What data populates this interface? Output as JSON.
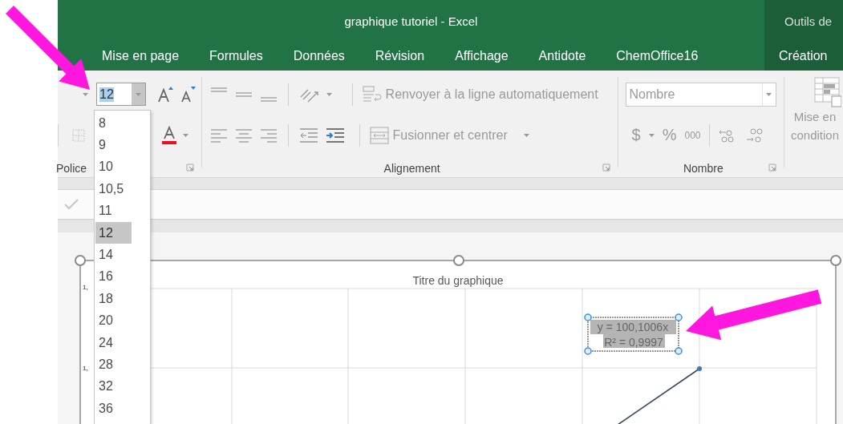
{
  "window": {
    "title": "graphique tutoriel - Excel",
    "context_group": "Outils de"
  },
  "tabs": [
    {
      "label": "Mise en page",
      "kind": "normal"
    },
    {
      "label": "Formules",
      "kind": "normal"
    },
    {
      "label": "Données",
      "kind": "normal"
    },
    {
      "label": "Révision",
      "kind": "normal"
    },
    {
      "label": "Affichage",
      "kind": "normal"
    },
    {
      "label": "Antidote",
      "kind": "normal"
    },
    {
      "label": "ChemOffice16",
      "kind": "normal"
    },
    {
      "label": "Création",
      "kind": "contextual"
    }
  ],
  "ribbon": {
    "font": {
      "size": "12",
      "group_label": "Police"
    },
    "alignment": {
      "wrap_label": "Renvoyer à la ligne automatiquement",
      "merge_label": "Fusionner et centrer",
      "group_label": "Alignement"
    },
    "number": {
      "format": "Nombre",
      "currency": "$",
      "percent": "%",
      "thousands": "000",
      "group_label": "Nombre"
    },
    "styles": {
      "conditional_label_lines": [
        "Mise en",
        "condition"
      ]
    }
  },
  "font_sizes": [
    {
      "label": "8",
      "selected": false
    },
    {
      "label": "9",
      "selected": false
    },
    {
      "label": "10",
      "selected": false
    },
    {
      "label": "10,5",
      "selected": false
    },
    {
      "label": "11",
      "selected": false
    },
    {
      "label": "12",
      "selected": true
    },
    {
      "label": "14",
      "selected": false
    },
    {
      "label": "16",
      "selected": false
    },
    {
      "label": "18",
      "selected": false
    },
    {
      "label": "20",
      "selected": false
    },
    {
      "label": "24",
      "selected": false
    },
    {
      "label": "28",
      "selected": false
    },
    {
      "label": "32",
      "selected": false
    },
    {
      "label": "36",
      "selected": false
    }
  ],
  "chart": {
    "title": "Titre du graphique",
    "y_ticks": [
      "1,",
      "1,"
    ],
    "trendline_label": [
      "y = 100,1006x",
      "R² = 0,9997"
    ]
  }
}
